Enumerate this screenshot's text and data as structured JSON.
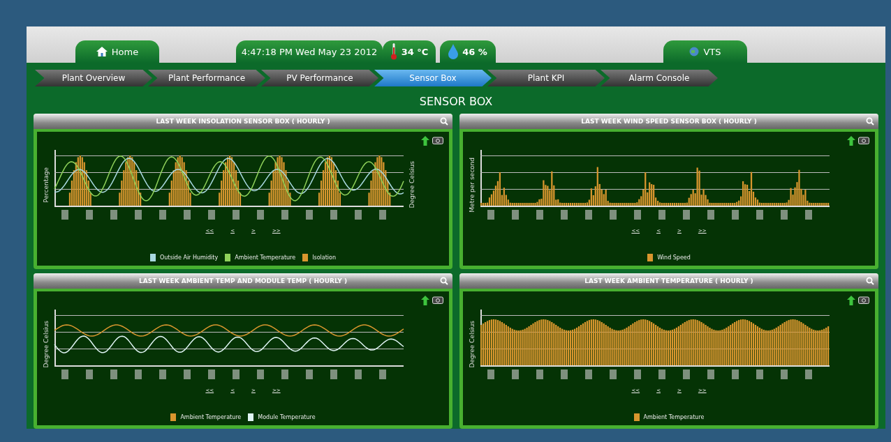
{
  "header": {
    "home_tab": "Home",
    "clock": "4:47:18  PM Wed May 23 2012",
    "temperature": "34 °C",
    "humidity": "46 %",
    "vts_tab": "VTS"
  },
  "nav": [
    {
      "label": "Plant Overview",
      "selected": false
    },
    {
      "label": "Plant Performance",
      "selected": false
    },
    {
      "label": "PV Performance",
      "selected": false
    },
    {
      "label": "Sensor Box",
      "selected": true
    },
    {
      "label": "Plant KPI",
      "selected": false
    },
    {
      "label": "Alarm Console",
      "selected": false
    }
  ],
  "page_title": "SENSOR BOX",
  "panels": [
    {
      "title": "LAST WEEK INSOLATION SENSOR BOX ( HOURLY )",
      "kind": "insolation",
      "y_left": "Percentage",
      "y_right": "Degree Celsius",
      "pager": [
        "<<",
        "<",
        ">",
        ">>"
      ],
      "legend": [
        {
          "label": "Outside Air Humidity",
          "color": "#a8d8e0"
        },
        {
          "label": "Ambient Temperature",
          "color": "#8fd15a"
        },
        {
          "label": "Isolation",
          "color": "#d9962e"
        }
      ]
    },
    {
      "title": "LAST WEEK WIND SPEED SENSOR BOX ( HOURLY )",
      "kind": "wind",
      "y_left": "Metre per second",
      "pager": [
        "<<",
        "<",
        ">",
        ">>"
      ],
      "legend": [
        {
          "label": "Wind Speed",
          "color": "#d9962e"
        }
      ]
    },
    {
      "title": "LAST WEEK AMBIENT TEMP AND MODULE TEMP ( HOURLY )",
      "kind": "temps",
      "y_left": "Degree Celsius",
      "pager": [
        "<<",
        "<",
        ">",
        ">>"
      ],
      "legend": [
        {
          "label": "Ambient Temperature",
          "color": "#d9962e"
        },
        {
          "label": "Module Temperature",
          "color": "#e0f4f4"
        }
      ]
    },
    {
      "title": "LAST WEEK AMBIENT TEMPERATURE ( HOURLY )",
      "kind": "ambient",
      "y_left": "Degree Celsius",
      "pager": [
        "<<",
        "<",
        ">",
        ">>"
      ],
      "legend": [
        {
          "label": "Ambient Temperature",
          "color": "#d9962e"
        }
      ]
    }
  ]
}
